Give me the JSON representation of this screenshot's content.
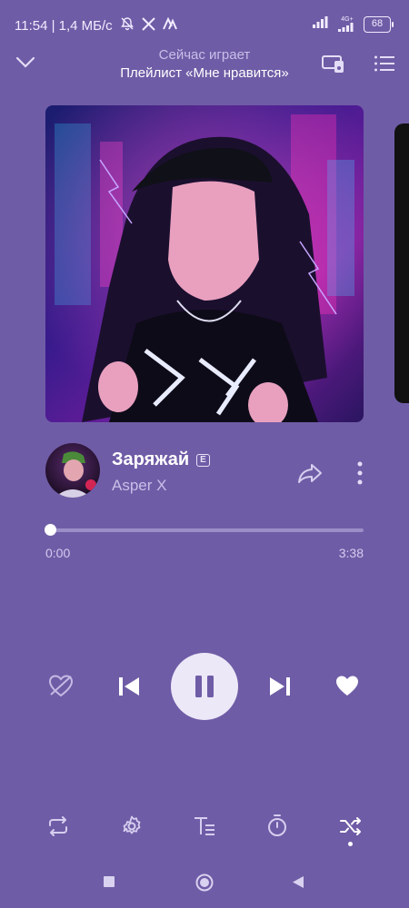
{
  "status_bar": {
    "time_speed": "11:54 | 1,4 МБ/с",
    "network_label": "4G+",
    "battery": "68",
    "icons": [
      "bell-muted-icon",
      "x-logo-icon",
      "app-icon",
      "signal-icon",
      "wifi-icon",
      "battery-icon"
    ]
  },
  "header": {
    "title": "Сейчас играет",
    "subtitle": "Плейлист «Мне нравится»"
  },
  "track": {
    "title": "Заряжай",
    "explicit_badge": "E",
    "artist": "Asper X"
  },
  "progress": {
    "current_time": "0:00",
    "total_time": "3:38",
    "fraction": 0.01
  },
  "controls": {
    "icons": [
      "dislike-icon",
      "previous-icon",
      "pause-icon",
      "next-icon",
      "like-icon"
    ]
  },
  "toolbar": {
    "icons": [
      "repeat-icon",
      "settings-icon",
      "lyrics-icon",
      "timer-icon",
      "shuffle-icon"
    ]
  },
  "colors": {
    "background": "#6f5ca6",
    "text_secondary": "#c8bfe8",
    "play_button": "#ece8f8"
  }
}
